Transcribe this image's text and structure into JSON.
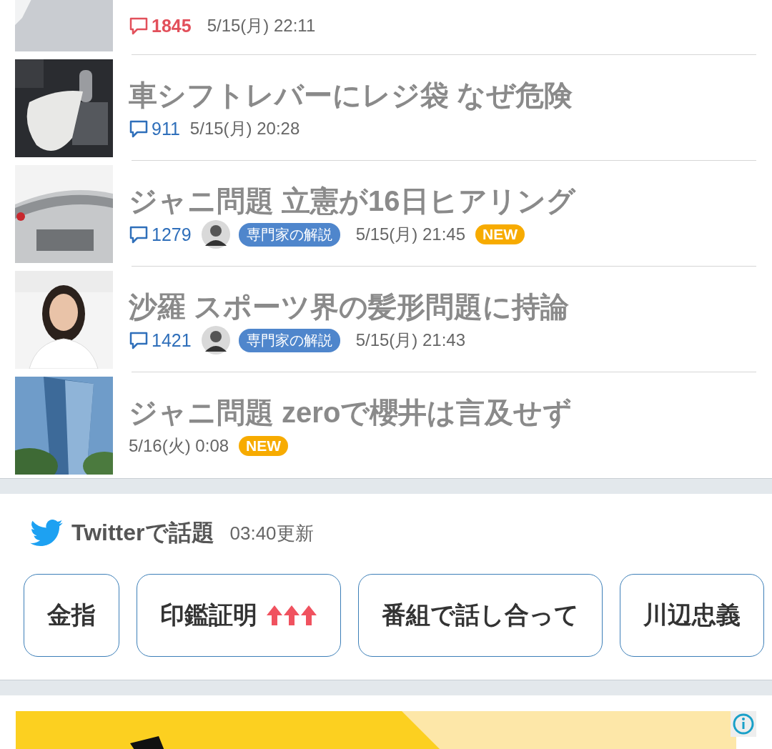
{
  "articles": [
    {
      "comments": "1845",
      "hot": true,
      "date": "5/15(月) 22:11",
      "is_new": false
    },
    {
      "title": "車シフトレバーにレジ袋 なぜ危険",
      "comments": "911",
      "hot": false,
      "date": "5/15(月) 20:28",
      "is_new": false
    },
    {
      "title": "ジャニ問題 立憲が16日ヒアリング",
      "comments": "1279",
      "hot": false,
      "expert": "専門家の解説",
      "date": "5/15(月) 21:45",
      "is_new": true,
      "new_label": "NEW"
    },
    {
      "title": "沙羅 スポーツ界の髪形問題に持論",
      "comments": "1421",
      "hot": false,
      "expert": "専門家の解説",
      "date": "5/15(月) 21:43",
      "is_new": false
    },
    {
      "title": "ジャニ問題 zeroで櫻井は言及せず",
      "date": "5/16(火) 0:08",
      "is_new": true,
      "new_label": "NEW"
    }
  ],
  "twitter": {
    "title": "Twitterで話題",
    "updated": "03:40更新",
    "topics": [
      {
        "label": "金指",
        "rising": false
      },
      {
        "label": "印鑑証明",
        "rising": true
      },
      {
        "label": "番組で話し合って",
        "rising": false
      },
      {
        "label": "川辺忠義",
        "rising": false
      }
    ]
  }
}
